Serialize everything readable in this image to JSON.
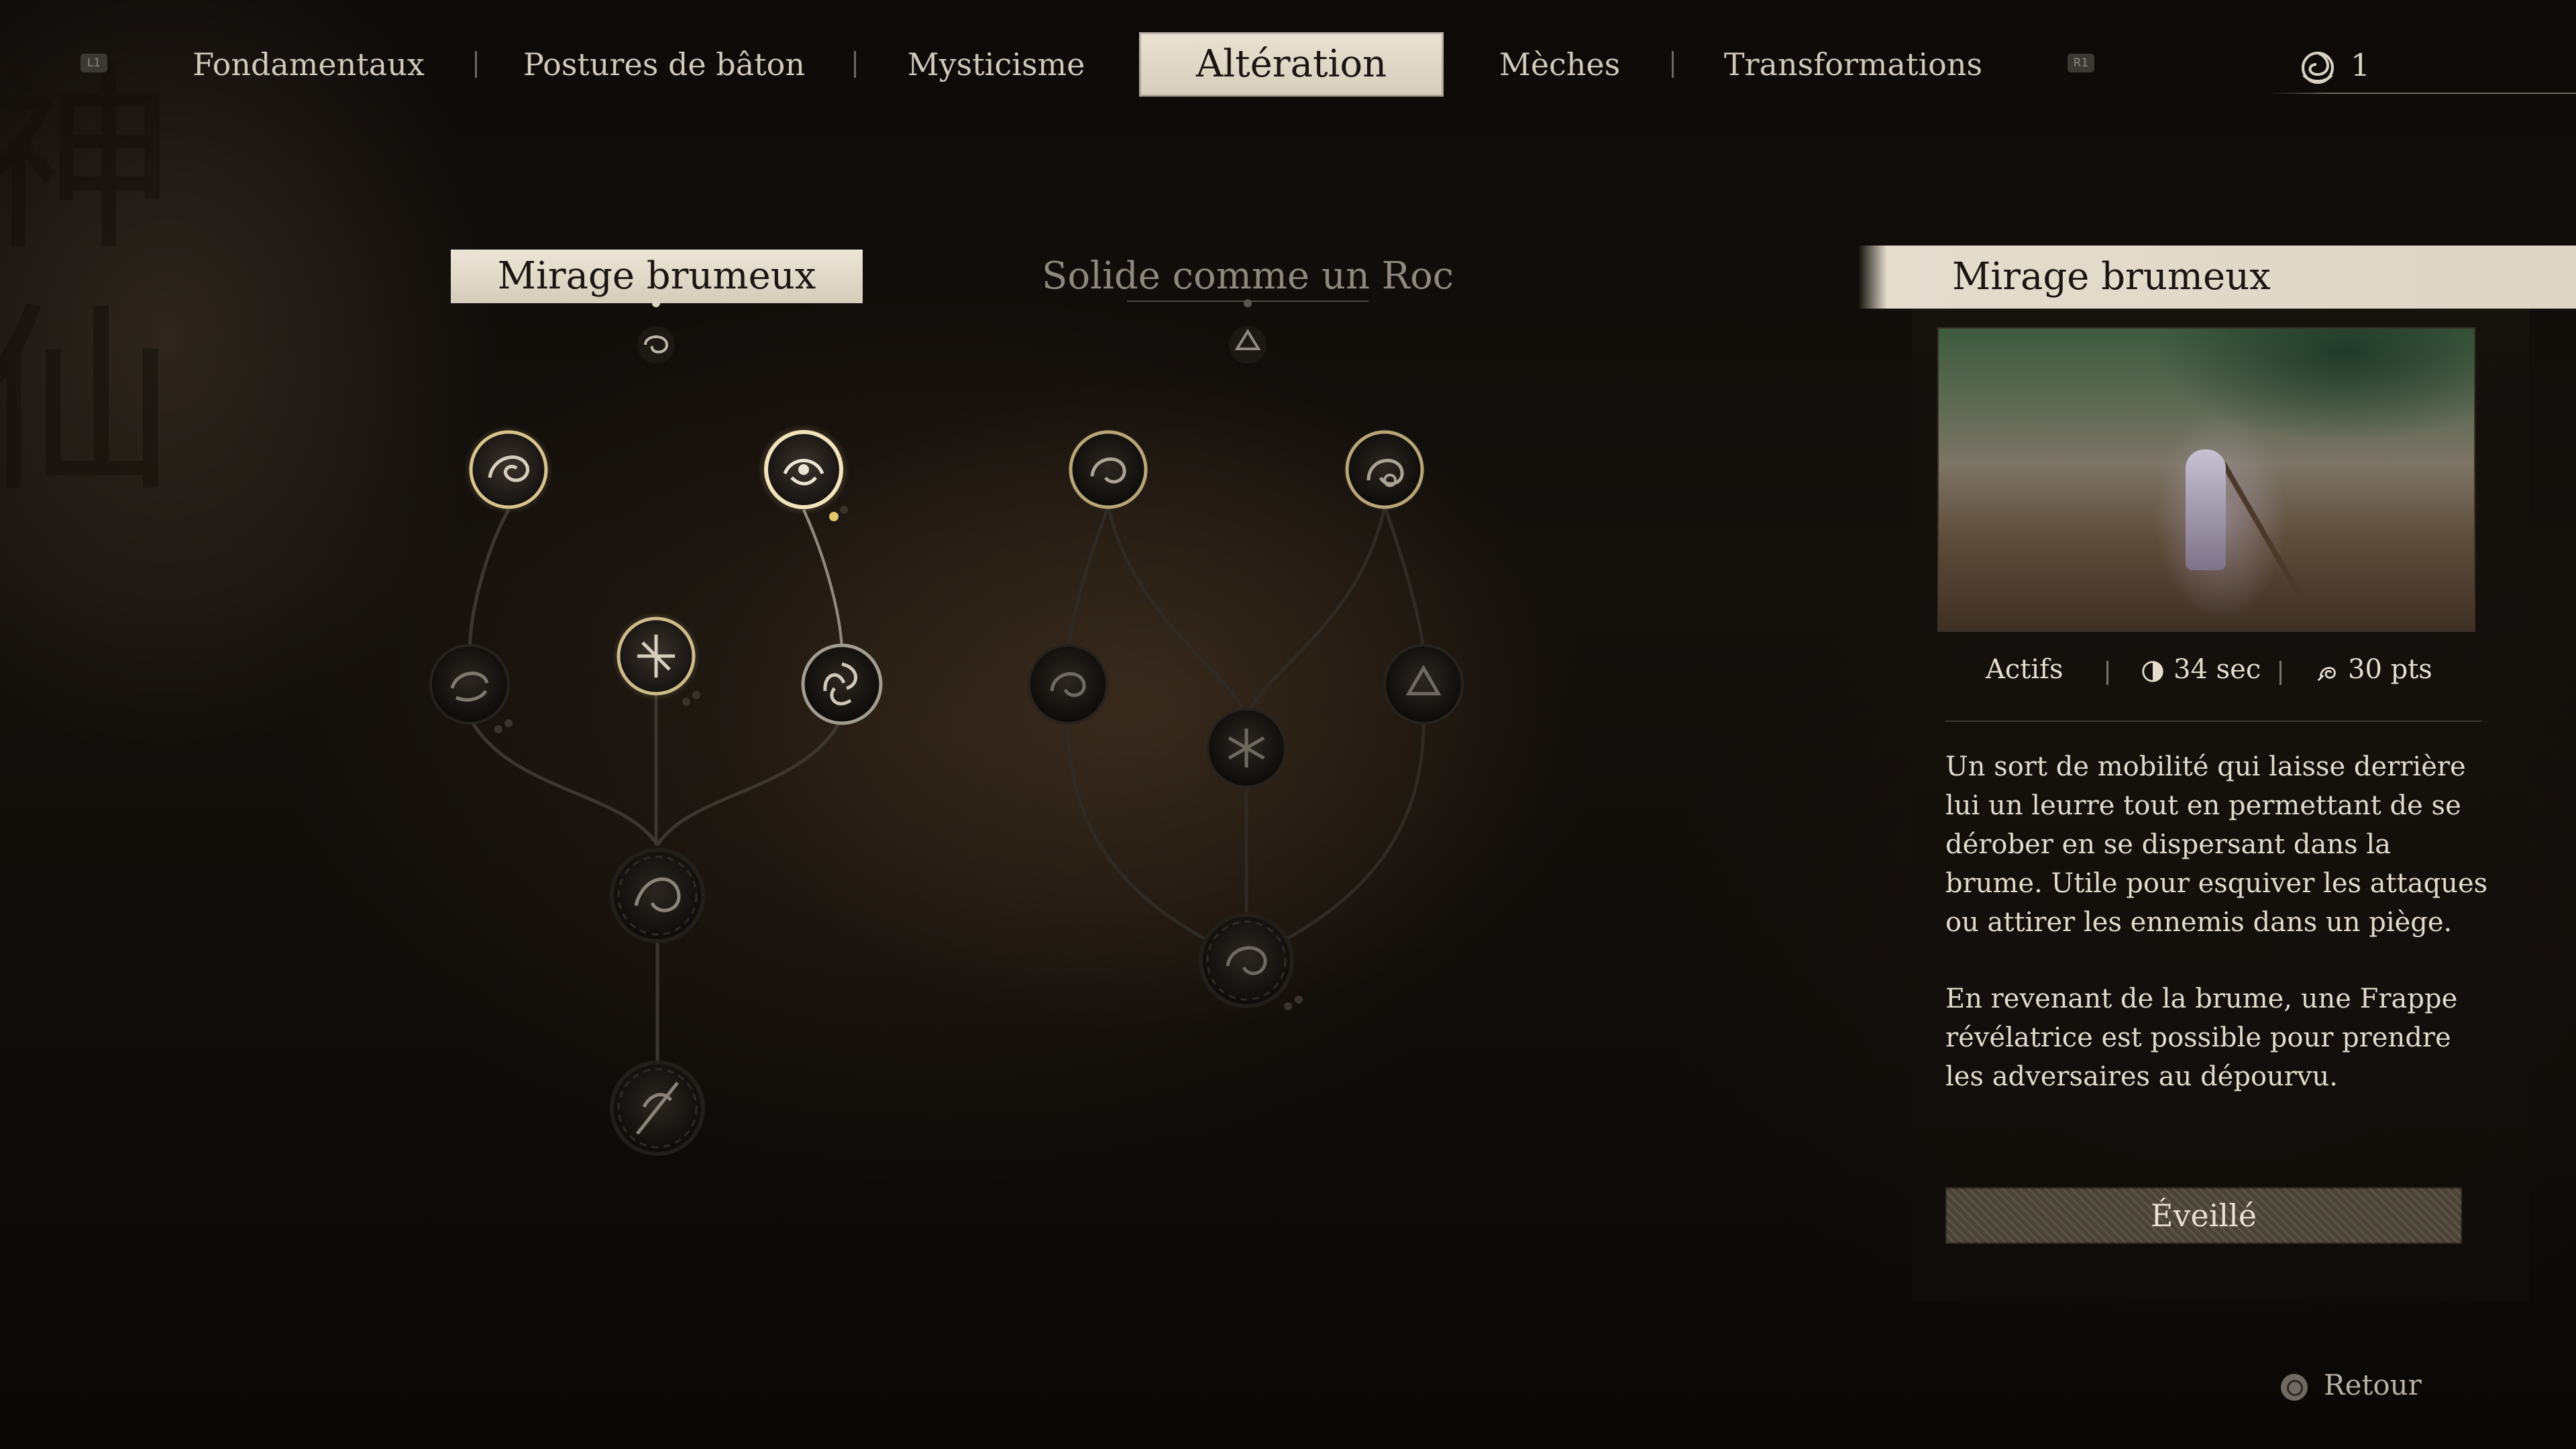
{
  "nav": {
    "left_shoulder": "L1",
    "right_shoulder": "R1",
    "tabs": [
      {
        "label": "Fondamentaux",
        "active": false
      },
      {
        "label": "Postures de bâton",
        "active": false
      },
      {
        "label": "Mysticisme",
        "active": false
      },
      {
        "label": "Altération",
        "active": true
      },
      {
        "label": "Mèches",
        "active": false
      },
      {
        "label": "Transformations",
        "active": false
      }
    ],
    "currency": {
      "icon": "spirit-swirl-icon",
      "value": "1"
    }
  },
  "trees": [
    {
      "title": "Mirage brumeux",
      "state": "selected",
      "header_icon": "mist-swirl-icon"
    },
    {
      "title": "Solide comme un Roc",
      "state": "dim",
      "header_icon": "rock-swirl-icon"
    }
  ],
  "detail": {
    "title": "Mirage brumeux",
    "preview": {
      "alt_icon": "gameplay-preview-image"
    },
    "stats": {
      "type": "Actifs",
      "cooldown": "34 sec",
      "cooldown_icon": "cooldown-moon-icon",
      "cost": "30 pts",
      "cost_icon": "mana-swirl-icon"
    },
    "description": [
      "Un sort de mobilité qui laisse derrière lui un leurre tout en permettant de se dérober en se dispersant dans la brume. Utile pour esquiver les attaques ou attirer les ennemis dans un piège.",
      "En revenant de la brume, une Frappe révélatrice est possible pour prendre les adversaires au dépourvu."
    ],
    "action_label": "Éveillé"
  },
  "footer": {
    "back_label": "Retour",
    "back_icon": "circle-button-icon"
  },
  "colors": {
    "accent_gold": "#c9b27a",
    "parchment": "#e4ddce",
    "background": "#0b0907"
  }
}
